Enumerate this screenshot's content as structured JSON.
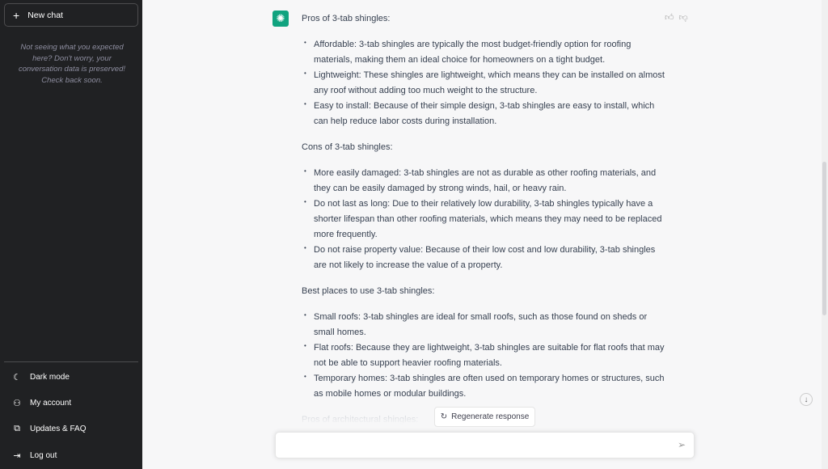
{
  "sidebar": {
    "new_chat": "New chat",
    "note": "Not seeing what you expected here? Don't worry, your conversation data is preserved! Check back soon.",
    "menu": [
      {
        "label": "Dark mode",
        "icon": "moon-icon"
      },
      {
        "label": "My account",
        "icon": "user-icon"
      },
      {
        "label": "Updates & FAQ",
        "icon": "external-link-icon"
      },
      {
        "label": "Log out",
        "icon": "logout-icon"
      }
    ]
  },
  "message": {
    "sections": [
      {
        "heading": "Pros of 3-tab shingles:",
        "items": [
          "Affordable: 3-tab shingles are typically the most budget-friendly option for roofing materials, making them an ideal choice for homeowners on a tight budget.",
          "Lightweight: These shingles are lightweight, which means they can be installed on almost any roof without adding too much weight to the structure.",
          "Easy to install: Because of their simple design, 3-tab shingles are easy to install, which can help reduce labor costs during installation."
        ]
      },
      {
        "heading": "Cons of 3-tab shingles:",
        "items": [
          "More easily damaged: 3-tab shingles are not as durable as other roofing materials, and they can be easily damaged by strong winds, hail, or heavy rain.",
          "Do not last as long: Due to their relatively low durability, 3-tab shingles typically have a shorter lifespan than other roofing materials, which means they may need to be replaced more frequently.",
          "Do not raise property value: Because of their low cost and low durability, 3-tab shingles are not likely to increase the value of a property."
        ]
      },
      {
        "heading": "Best places to use 3-tab shingles:",
        "items": [
          "Small roofs: 3-tab shingles are ideal for small roofs, such as those found on sheds or small homes.",
          "Flat roofs: Because they are lightweight, 3-tab shingles are suitable for flat roofs that may not be able to support heavier roofing materials.",
          "Temporary homes: 3-tab shingles are often used on temporary homes or structures, such as mobile homes or modular buildings."
        ]
      }
    ],
    "trailing": "Pros of architectural shingles:"
  },
  "regenerate": "Regenerate response",
  "input": {
    "value": "",
    "placeholder": ""
  },
  "colors": {
    "sidebar": "#202123",
    "accent": "#10a37f",
    "background": "#f7f7f8"
  }
}
